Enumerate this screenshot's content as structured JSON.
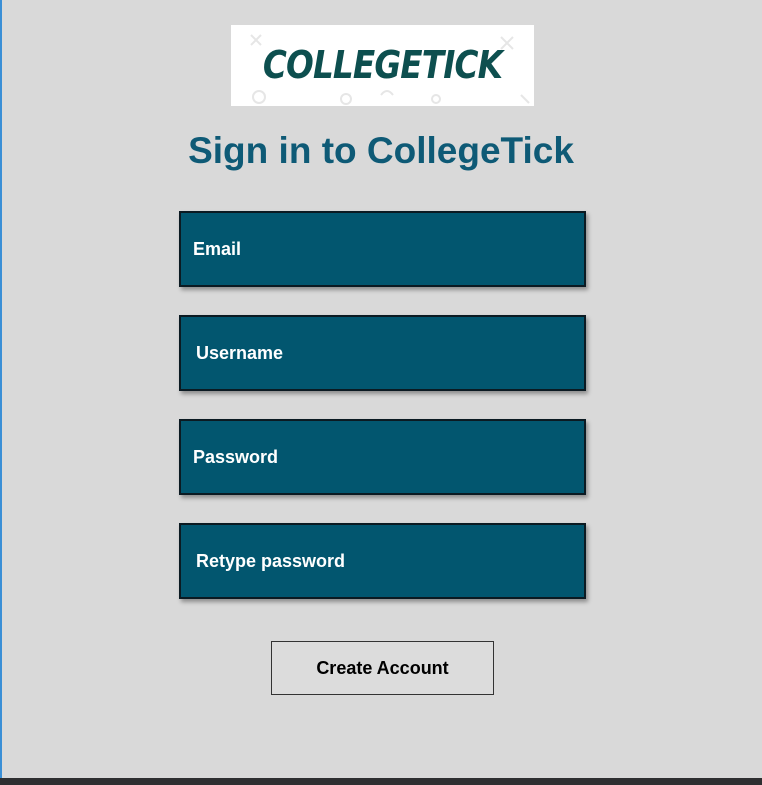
{
  "logo": {
    "text": "COLLEGETICK"
  },
  "page_title": "Sign in to CollegeTick",
  "form": {
    "email": {
      "placeholder": "Email",
      "value": ""
    },
    "username": {
      "placeholder": "Username",
      "value": ""
    },
    "password": {
      "placeholder": "Password",
      "value": ""
    },
    "retype_password": {
      "placeholder": "Retype password",
      "value": ""
    }
  },
  "create_account_button": "Create Account",
  "colors": {
    "background": "#d9d9d9",
    "field_fill": "#02566f",
    "title": "#0e5a76",
    "logo_text": "#0d4f4f"
  }
}
